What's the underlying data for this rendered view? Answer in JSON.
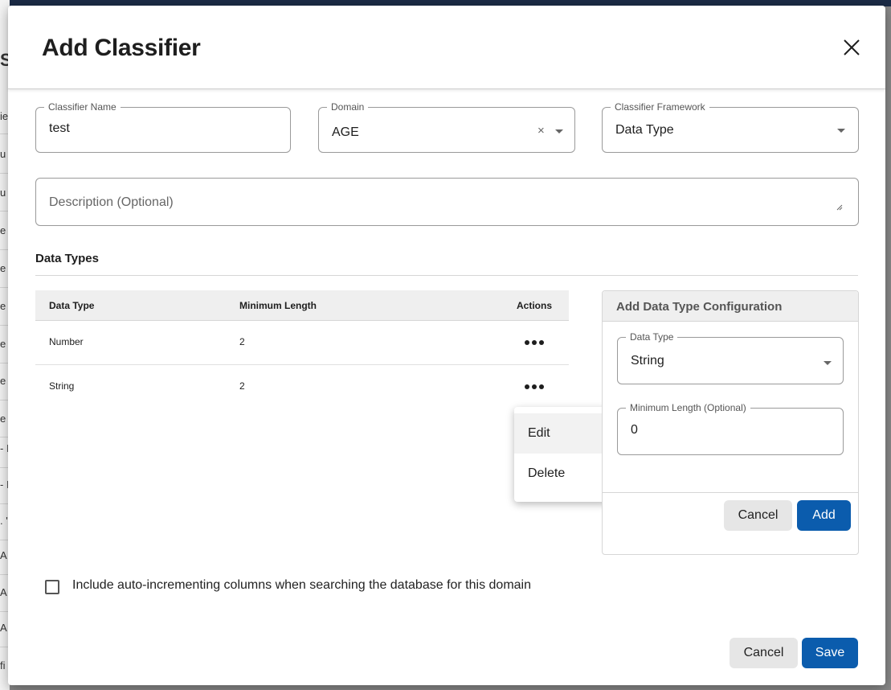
{
  "background": {
    "letters": [
      "S",
      "ie",
      "u",
      "u",
      "e",
      "e",
      "e",
      "e",
      "e",
      "e",
      "- I",
      "- I",
      ". '",
      "A",
      "A",
      "A",
      "fi"
    ]
  },
  "dialog": {
    "title": "Add Classifier",
    "close_icon": "close-icon"
  },
  "form": {
    "classifier_name": {
      "label": "Classifier Name",
      "value": "test"
    },
    "domain": {
      "label": "Domain",
      "value": "AGE",
      "clear": "×"
    },
    "classifier_framework": {
      "label": "Classifier Framework",
      "value": "Data Type"
    },
    "description": {
      "placeholder": "Description (Optional)"
    }
  },
  "data_types": {
    "section_title": "Data Types",
    "columns": [
      "Data Type",
      "Minimum Length",
      "Actions"
    ],
    "rows": [
      {
        "data_type": "Number",
        "min_length": "2"
      },
      {
        "data_type": "String",
        "min_length": "2"
      }
    ],
    "menu": [
      "Edit",
      "Delete"
    ]
  },
  "config_panel": {
    "title": "Add Data Type Configuration",
    "data_type": {
      "label": "Data Type",
      "value": "String"
    },
    "min_length": {
      "label": "Minimum Length (Optional)",
      "value": "0"
    },
    "cancel_label": "Cancel",
    "add_label": "Add"
  },
  "checkbox": {
    "label": "Include auto-incrementing columns when searching the database for this domain",
    "checked": false
  },
  "footer": {
    "cancel_label": "Cancel",
    "save_label": "Save"
  },
  "colors": {
    "primary": "#0b5cad",
    "secondary_button": "#e6e6e6",
    "header_bar": "#1b2b46"
  }
}
